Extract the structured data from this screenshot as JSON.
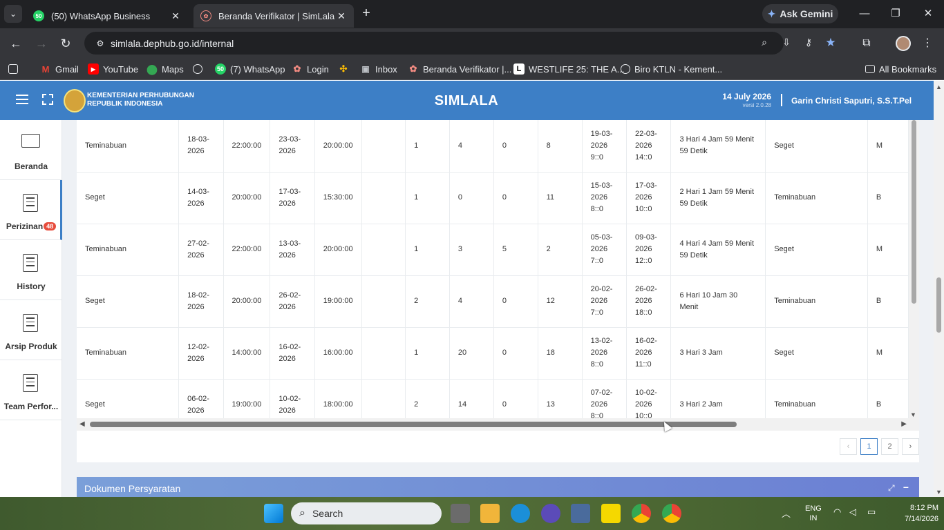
{
  "browser": {
    "tabs": [
      {
        "label": "(50) WhatsApp Business",
        "favicon": "50"
      },
      {
        "label": "Beranda Verifikator | SimLala"
      }
    ],
    "gemini_label": "Ask Gemini",
    "url": "simlala.dephub.go.id/internal",
    "bookmarks": [
      "Gmail",
      "YouTube",
      "Maps",
      "(7) WhatsApp",
      "Login",
      "Inbox",
      "Beranda Verifikator |...",
      "WESTLIFE 25: THE A...",
      "Biro KTLN - Kement...",
      "All Bookmarks"
    ],
    "whatsapp_badge": "50"
  },
  "app": {
    "ministry_line1": "KEMENTERIAN PERHUBUNGAN",
    "ministry_line2": "REPUBLIK INDONESIA",
    "name": "SIMLALA",
    "date": "14 July 2026",
    "version": "versi 2.0.28",
    "user": "Garin Christi Saputri, S.S.T.Pel"
  },
  "sidebar": {
    "items": [
      {
        "label": "Beranda"
      },
      {
        "label": "Perizinan",
        "badge": "48"
      },
      {
        "label": "History"
      },
      {
        "label": "Arsip Produk"
      },
      {
        "label": "Team Perfor..."
      }
    ]
  },
  "table": {
    "rows": [
      [
        "Teminabuan",
        "18-03-2026",
        "22:00:00",
        "23-03-2026",
        "20:00:00",
        "",
        "1",
        "4",
        "0",
        "8",
        "19-03-2026 9::0",
        "22-03-2026 14::0",
        "3 Hari 4 Jam 59 Menit 59 Detik",
        "Seget",
        "M"
      ],
      [
        "Seget",
        "14-03-2026",
        "20:00:00",
        "17-03-2026",
        "15:30:00",
        "",
        "1",
        "0",
        "0",
        "11",
        "15-03-2026 8::0",
        "17-03-2026 10::0",
        "2 Hari 1 Jam 59 Menit 59 Detik",
        "Teminabuan",
        "B"
      ],
      [
        "Teminabuan",
        "27-02-2026",
        "22:00:00",
        "13-03-2026",
        "20:00:00",
        "",
        "1",
        "3",
        "5",
        "2",
        "05-03-2026 7::0",
        "09-03-2026 12::0",
        "4 Hari 4 Jam 59 Menit 59 Detik",
        "Seget",
        "M"
      ],
      [
        "Seget",
        "18-02-2026",
        "20:00:00",
        "26-02-2026",
        "19:00:00",
        "",
        "2",
        "4",
        "0",
        "12",
        "20-02-2026 7::0",
        "26-02-2026 18::0",
        "6 Hari 10 Jam 30 Menit",
        "Teminabuan",
        "B"
      ],
      [
        "Teminabuan",
        "12-02-2026",
        "14:00:00",
        "16-02-2026",
        "16:00:00",
        "",
        "1",
        "20",
        "0",
        "18",
        "13-02-2026 8::0",
        "16-02-2026 11::0",
        "3 Hari 3 Jam",
        "Seget",
        "M"
      ],
      [
        "Seget",
        "06-02-2026",
        "19:00:00",
        "10-02-2026",
        "18:00:00",
        "",
        "2",
        "14",
        "0",
        "13",
        "07-02-2026 8::0",
        "10-02-2026 10::0",
        "3 Hari 2 Jam",
        "Teminabuan",
        "B"
      ]
    ]
  },
  "pagination": {
    "prev": "‹",
    "pages": [
      "1",
      "2"
    ],
    "next": "›"
  },
  "dokumen_title": "Dokumen Persyaratan",
  "taskbar": {
    "search_placeholder": "Search",
    "lang1": "ENG",
    "lang2": "IN",
    "time": "8:12 PM",
    "date": "7/14/2026"
  }
}
